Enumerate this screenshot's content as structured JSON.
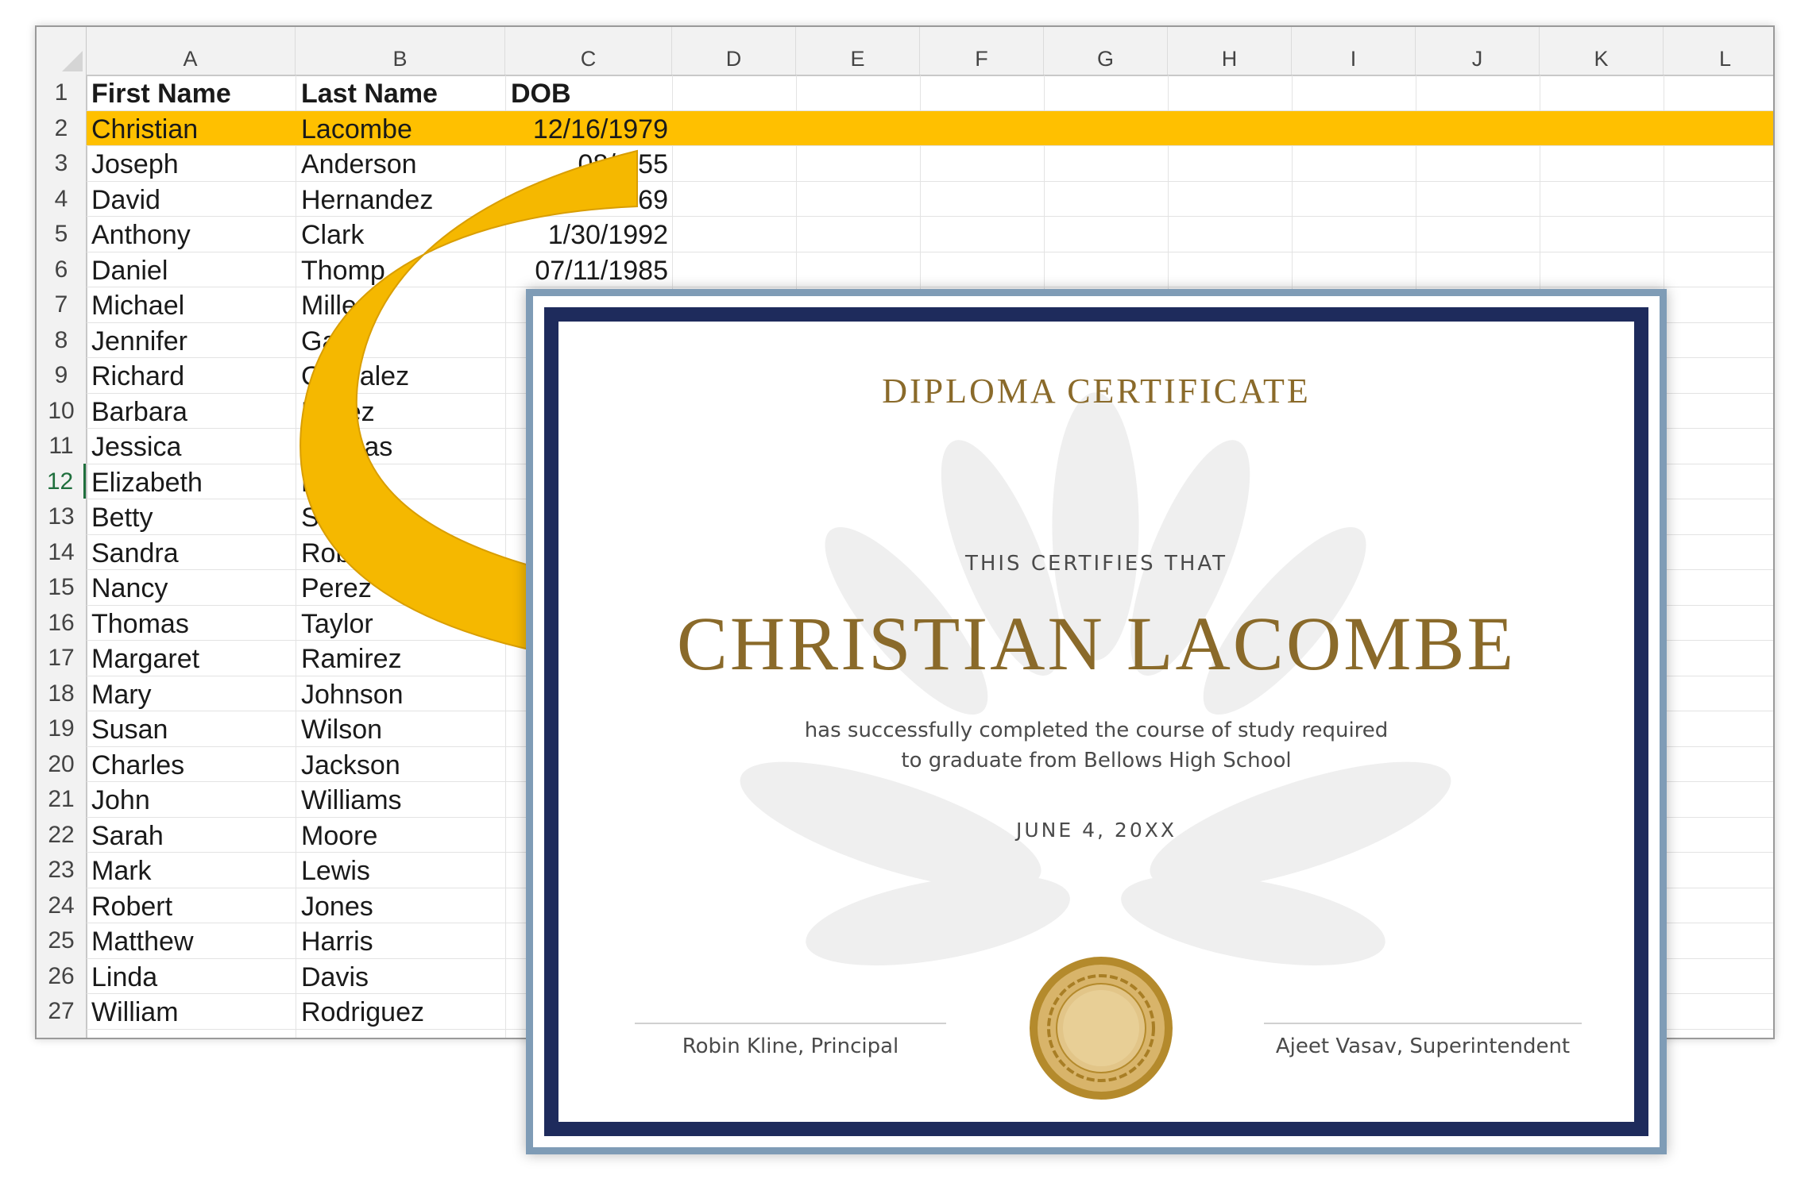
{
  "spreadsheet": {
    "columns": [
      "A",
      "B",
      "C",
      "D",
      "E",
      "F",
      "G",
      "H",
      "I",
      "J",
      "K",
      "L"
    ],
    "selected_row": "12",
    "highlight_row": "2",
    "header_row": {
      "num": "1",
      "first": "First Name",
      "last": "Last Name",
      "dob": "DOB"
    },
    "rows": [
      {
        "num": "2",
        "first": "Christian",
        "last": "Lacombe",
        "dob": "12/16/1979"
      },
      {
        "num": "3",
        "first": "Joseph",
        "last": "Anderson",
        "dob": "08/0  55"
      },
      {
        "num": "4",
        "first": "David",
        "last": "Hernandez",
        "dob": "69"
      },
      {
        "num": "5",
        "first": "Anthony",
        "last": "Clark",
        "dob": "1/30/1992"
      },
      {
        "num": "6",
        "first": "Daniel",
        "last": "Thomp",
        "dob": "07/11/1985"
      },
      {
        "num": "7",
        "first": "Michael",
        "last": "Miller",
        "dob": ""
      },
      {
        "num": "8",
        "first": "Jennifer",
        "last": "Garc",
        "dob": ""
      },
      {
        "num": "9",
        "first": "Richard",
        "last": "Gon  alez",
        "dob": ""
      },
      {
        "num": "10",
        "first": "Barbara",
        "last": "Lopez",
        "dob": ""
      },
      {
        "num": "11",
        "first": "Jessica",
        "last": "Thor  as",
        "dob": ""
      },
      {
        "num": "12",
        "first": "Elizabeth",
        "last": "Marti  z",
        "dob": ""
      },
      {
        "num": "13",
        "first": "Betty",
        "last": "Sanch",
        "dob": ""
      },
      {
        "num": "14",
        "first": "Sandra",
        "last": "Robinso",
        "dob": ""
      },
      {
        "num": "15",
        "first": "Nancy",
        "last": "Perez",
        "dob": ""
      },
      {
        "num": "16",
        "first": "Thomas",
        "last": "Taylor",
        "dob": ""
      },
      {
        "num": "17",
        "first": "Margaret",
        "last": "Ramirez",
        "dob": ""
      },
      {
        "num": "18",
        "first": "Mary",
        "last": "Johnson",
        "dob": ""
      },
      {
        "num": "19",
        "first": "Susan",
        "last": "Wilson",
        "dob": ""
      },
      {
        "num": "20",
        "first": "Charles",
        "last": "Jackson",
        "dob": ""
      },
      {
        "num": "21",
        "first": "John",
        "last": "Williams",
        "dob": ""
      },
      {
        "num": "22",
        "first": "Sarah",
        "last": "Moore",
        "dob": ""
      },
      {
        "num": "23",
        "first": "Mark",
        "last": "Lewis",
        "dob": ""
      },
      {
        "num": "24",
        "first": "Robert",
        "last": "Jones",
        "dob": ""
      },
      {
        "num": "25",
        "first": "Matthew",
        "last": "Harris",
        "dob": ""
      },
      {
        "num": "26",
        "first": "Linda",
        "last": "Davis",
        "dob": ""
      },
      {
        "num": "27",
        "first": "William",
        "last": "Rodriguez",
        "dob": ""
      }
    ]
  },
  "certificate": {
    "title": "DIPLOMA CERTIFICATE",
    "certifies": "THIS CERTIFIES THAT",
    "name": "CHRISTIAN LACOMBE",
    "description_line1": "has successfully completed the course of study required",
    "description_line2": "to graduate from Bellows High School",
    "date": "JUNE 4, 20XX",
    "signature_left": "Robin Kline, Principal",
    "signature_right": "Ajeet Vasav, Superintendent",
    "seal_icon": "gold-seal-icon",
    "watermark_icon": "laurel-leaf-icon"
  },
  "colors": {
    "highlight": "#ffc000",
    "arrow": "#f5b800",
    "gold_text": "#8a6a2a",
    "frame_navy": "#1e2b5c",
    "frame_outer": "#7f9cb6",
    "selected_row_green": "#1f6f3d"
  }
}
